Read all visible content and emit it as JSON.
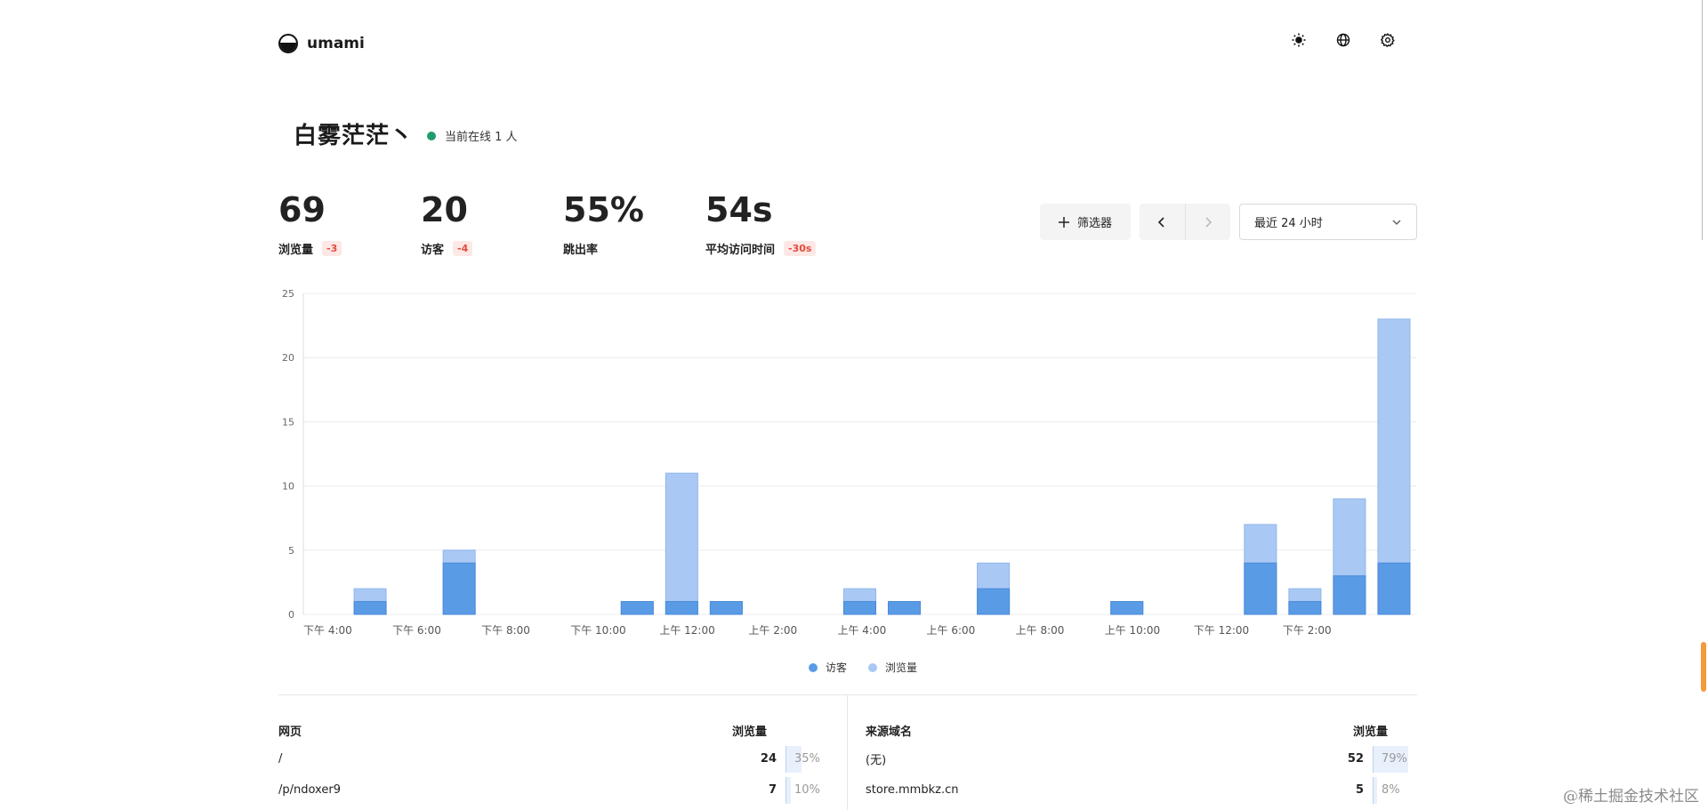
{
  "app": {
    "name": "umami"
  },
  "header": {
    "icons": [
      "sun-icon",
      "globe-icon",
      "gear-icon"
    ]
  },
  "site": {
    "title": "白雾茫茫丶",
    "online_text": "当前在线 1 人"
  },
  "metrics": [
    {
      "value": "69",
      "label": "浏览量",
      "delta": "-3"
    },
    {
      "value": "20",
      "label": "访客",
      "delta": "-4"
    },
    {
      "value": "55%",
      "label": "跳出率",
      "delta": ""
    },
    {
      "value": "54s",
      "label": "平均访问时间",
      "delta": "-30s"
    }
  ],
  "controls": {
    "filter_label": "筛选器",
    "range_label": "最近 24 小时"
  },
  "chart_data": {
    "type": "bar",
    "x_tick_labels": [
      "下午 4:00",
      "下午 6:00",
      "下午 8:00",
      "下午 10:00",
      "上午 12:00",
      "上午 2:00",
      "上午 4:00",
      "上午 6:00",
      "上午 8:00",
      "上午 10:00",
      "下午 12:00",
      "下午 2:00"
    ],
    "ylim": [
      0,
      25
    ],
    "y_ticks": [
      0,
      5,
      10,
      15,
      20,
      25
    ],
    "grid": true,
    "series": [
      {
        "name": "访客",
        "color": "#5a9be6",
        "values": [
          0,
          1,
          0,
          4,
          0,
          0,
          0,
          1,
          1,
          1,
          0,
          0,
          1,
          1,
          0,
          2,
          0,
          0,
          1,
          0,
          0,
          4,
          1,
          3,
          4
        ]
      },
      {
        "name": "浏览量",
        "color": "#a9c9f4",
        "values": [
          0,
          2,
          0,
          5,
          0,
          0,
          0,
          1,
          11,
          1,
          0,
          0,
          2,
          1,
          0,
          4,
          0,
          0,
          1,
          0,
          0,
          7,
          2,
          9,
          23
        ]
      }
    ],
    "legend_position": "bottom"
  },
  "tables": [
    {
      "title": "网页",
      "metric_label": "浏览量",
      "rows": [
        {
          "label": "/",
          "count": "24",
          "pct": "35%",
          "share": 0.35
        },
        {
          "label": "/p/ndoxer9",
          "count": "7",
          "pct": "10%",
          "share": 0.1
        }
      ]
    },
    {
      "title": "来源域名",
      "metric_label": "浏览量",
      "rows": [
        {
          "label": "(无)",
          "count": "52",
          "pct": "79%",
          "share": 0.79
        },
        {
          "label": "store.mmbkz.cn",
          "count": "5",
          "pct": "8%",
          "share": 0.08
        }
      ]
    }
  ],
  "watermark": "@稀土掘金技术社区"
}
